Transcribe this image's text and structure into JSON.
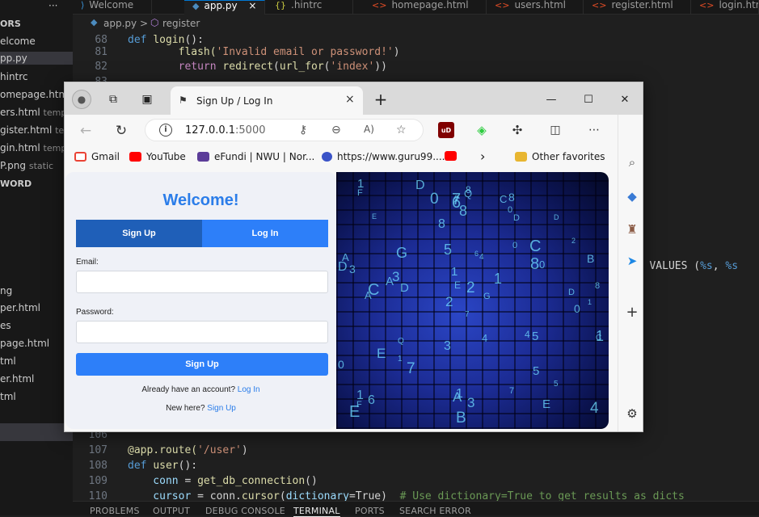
{
  "vscode": {
    "tabs": [
      {
        "label": "Welcome",
        "icon": "vscode-icon",
        "active": false
      },
      {
        "label": "app.py",
        "icon": "python-icon",
        "active": true
      },
      {
        "label": ".hintrc",
        "icon": "braces-icon",
        "active": false
      },
      {
        "label": "homepage.html",
        "icon": "html-icon",
        "active": false
      },
      {
        "label": "users.html",
        "icon": "html-icon",
        "active": false
      },
      {
        "label": "register.html",
        "icon": "html-icon",
        "active": false
      },
      {
        "label": "login.htm",
        "icon": "html-icon",
        "active": false
      }
    ],
    "tab_close": "×",
    "breadcrumb": {
      "file": "app.py",
      "sep": ">",
      "symbol": "register"
    },
    "sidebar": {
      "header1": "ORS",
      "items": [
        {
          "label": "elcome",
          "hint": ""
        },
        {
          "label": "pp.py",
          "hint": ""
        },
        {
          "label": "hintrc",
          "hint": ""
        },
        {
          "label": "omepage.html",
          "hint": ""
        },
        {
          "label": "ers.html",
          "hint": "temp"
        },
        {
          "label": "gister.html",
          "hint": "te"
        },
        {
          "label": "gin.html",
          "hint": "templ"
        },
        {
          "label": "P.png",
          "hint": "static"
        }
      ],
      "header2": "WORD",
      "items2": [
        "ng",
        "per.html",
        "es",
        "page.html",
        "tml",
        "er.html",
        "tml"
      ]
    },
    "code_top": [
      {
        "ln": "68",
        "parts": [
          {
            "t": "def ",
            "c": "kw"
          },
          {
            "t": "login",
            "c": "fn"
          },
          {
            "t": "():",
            "c": "pl"
          }
        ]
      },
      {
        "ln": "81",
        "parts": [
          {
            "t": "        flash(",
            "c": "fn"
          },
          {
            "t": "'Invalid email or password!'",
            "c": "str"
          },
          {
            "t": ")",
            "c": "pl"
          }
        ]
      },
      {
        "ln": "82",
        "parts": [
          {
            "t": "        ",
            "c": "pl"
          },
          {
            "t": "return ",
            "c": "ctl"
          },
          {
            "t": "redirect",
            "c": "fn"
          },
          {
            "t": "(",
            "c": "pl"
          },
          {
            "t": "url_for",
            "c": "fn"
          },
          {
            "t": "(",
            "c": "pl"
          },
          {
            "t": "'index'",
            "c": "str"
          },
          {
            "t": "))",
            "c": "pl"
          }
        ]
      },
      {
        "ln": "83",
        "parts": []
      }
    ],
    "code_mid": {
      "t1": "n) VALUES (",
      "t2": "%s",
      "t3": ", ",
      "t4": "%s"
    },
    "code_bottom": [
      {
        "ln": "106",
        "parts": []
      },
      {
        "ln": "107",
        "parts": [
          {
            "t": "@app.route(",
            "c": "dec"
          },
          {
            "t": "'/user'",
            "c": "str"
          },
          {
            "t": ")",
            "c": "pl"
          }
        ]
      },
      {
        "ln": "108",
        "parts": [
          {
            "t": "def ",
            "c": "kw"
          },
          {
            "t": "user",
            "c": "fn"
          },
          {
            "t": "():",
            "c": "pl"
          }
        ]
      },
      {
        "ln": "109",
        "parts": [
          {
            "t": "    conn ",
            "c": "var"
          },
          {
            "t": "= ",
            "c": "pl"
          },
          {
            "t": "get_db_connection",
            "c": "fn"
          },
          {
            "t": "()",
            "c": "pl"
          }
        ]
      },
      {
        "ln": "110",
        "parts": [
          {
            "t": "    cursor ",
            "c": "var"
          },
          {
            "t": "= conn.",
            "c": "pl"
          },
          {
            "t": "cursor",
            "c": "fn"
          },
          {
            "t": "(",
            "c": "pl"
          },
          {
            "t": "dictionary",
            "c": "var"
          },
          {
            "t": "=True)  ",
            "c": "pl"
          },
          {
            "t": "# Use dictionary=True to get results as dicts",
            "c": "cm"
          }
        ]
      }
    ],
    "panel_tabs": [
      {
        "label": "PROBLEMS",
        "active": false
      },
      {
        "label": "OUTPUT",
        "active": false
      },
      {
        "label": "DEBUG CONSOLE",
        "active": false
      },
      {
        "label": "TERMINAL",
        "active": true
      },
      {
        "label": "PORTS",
        "active": false
      },
      {
        "label": "SEARCH ERROR",
        "active": false
      }
    ]
  },
  "edge": {
    "tab_title": "Sign Up / Log In",
    "new_tab": "+",
    "tab_close": "×",
    "window_controls": {
      "minimize": "—",
      "maximize": "☐",
      "close": "✕"
    },
    "address": {
      "host": "127.0.0.1",
      "port": ":5000"
    },
    "bookmarks": [
      {
        "label": "Gmail",
        "icon": "gmail-icon",
        "color": "#ea4335"
      },
      {
        "label": "YouTube",
        "icon": "youtube-icon",
        "color": "#ff0000"
      },
      {
        "label": "eFundi | NWU | Nor...",
        "icon": "efundi-icon",
        "color": "#5c3d99"
      },
      {
        "label": "https://www.guru99....",
        "icon": "guru99-icon",
        "color": "#3a53c7"
      },
      {
        "label": "",
        "icon": "youtube-icon",
        "color": "#ff0000"
      }
    ],
    "bookmarks_more": "›",
    "other_favorites": "Other favorites"
  },
  "auth": {
    "welcome": "Welcome!",
    "tab_signup": "Sign Up",
    "tab_login": "Log In",
    "email_label": "Email:",
    "email_value": "",
    "password_label": "Password:",
    "password_value": "",
    "submit": "Sign Up",
    "have_account": "Already have an account?",
    "have_account_link": "Log In",
    "new_here": "New here?",
    "new_here_link": "Sign Up",
    "accent": "#2b7de9",
    "tab_signup_color": "#1f5fb8",
    "tab_login_color": "#2d7ff9"
  },
  "matrix": {
    "glyphs": [
      "7",
      "D",
      "1",
      "5",
      "8",
      "Q",
      "G",
      "E",
      "C",
      "A",
      "0",
      "8",
      "4",
      "0",
      "F",
      "D",
      "1",
      "0",
      "6",
      "3",
      "B",
      "2",
      "E",
      "1",
      "7",
      "4",
      "5",
      "A",
      "3",
      "C",
      "D",
      "6",
      "1",
      "8",
      "2",
      "E"
    ]
  }
}
